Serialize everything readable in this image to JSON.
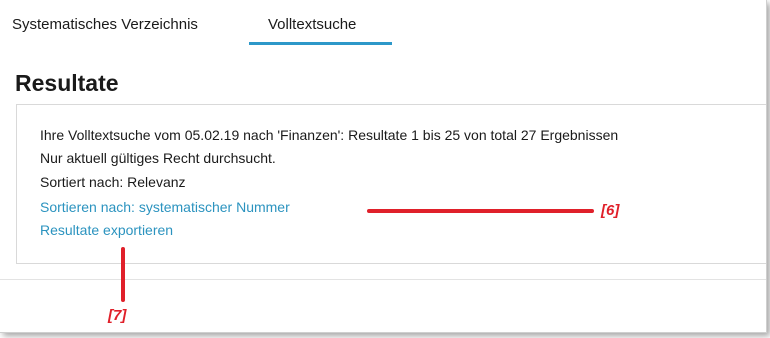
{
  "tabs": [
    {
      "label": "Systematisches Verzeichnis",
      "active": false
    },
    {
      "label": "Volltextsuche",
      "active": true
    }
  ],
  "page": {
    "title": "Resultate"
  },
  "results_panel": {
    "summary": "Ihre Volltextsuche vom 05.02.19 nach 'Finanzen': Resultate 1 bis 25 von total 27 Ergebnissen",
    "scope_note": "Nur aktuell gültiges Recht durchsucht.",
    "sort_status": "Sortiert nach: Relevanz",
    "sort_link": "Sortieren nach: systematischer Nummer",
    "export_link": "Resultate exportieren"
  },
  "annotations": {
    "callout_6": "[6]",
    "callout_7": "[7]"
  },
  "colors": {
    "link": "#2b93bf",
    "tab_underline": "#2d98c9",
    "annotation": "#e0202a"
  }
}
